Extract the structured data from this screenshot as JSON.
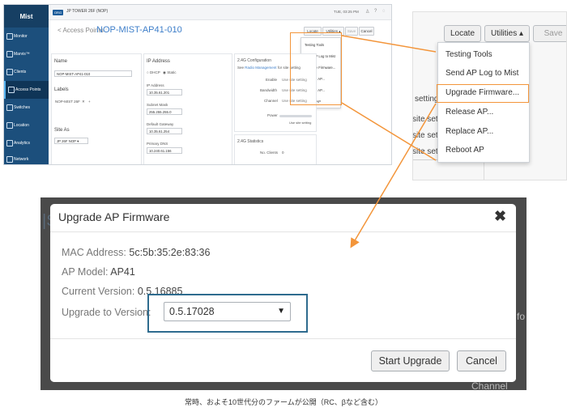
{
  "app": {
    "logo": "Mist",
    "org_badge": "ORG",
    "org_name": "JP TOWER 26F (NOP)",
    "time": "TUE, 03:25 PM",
    "sidebar": [
      {
        "label": "Monitor"
      },
      {
        "label": "Marvis™"
      },
      {
        "label": "Clients"
      },
      {
        "label": "Access Points"
      },
      {
        "label": "Switches"
      },
      {
        "label": "Location"
      },
      {
        "label": "Analytics"
      },
      {
        "label": "Network"
      }
    ],
    "back_label": "< Access Points :",
    "ap_title": "NOP-MIST-AP41-010",
    "toolbar": {
      "locate": "Locate",
      "utilities": "Utilities ▴",
      "save": "Save",
      "cancel": "Cancel"
    },
    "menu": [
      "Testing Tools",
      "Send AP Log to Mist",
      "Upgrade Firmware...",
      "Release AP...",
      "Replace AP...",
      "Reboot AP"
    ],
    "name_label": "Name",
    "name_value": "NOP-MIST-AP41-010",
    "labels_label": "Labels",
    "label_tag": "NOP-MIST 26F",
    "site_as_label": "Site As",
    "site_as_value": "JP 26F NOP",
    "ip_label": "IP Address",
    "ip_dhcp": "DHCP",
    "ip_static": "Static",
    "ip_addr_label": "IP Address",
    "ip_addr": "10.35.61.201",
    "mask_label": "Subnet Mask",
    "mask": "255.255.255.0",
    "gw_label": "Default Gateway",
    "gw": "10.35.61.254",
    "dns_label": "Primary DNS",
    "dns": "10.240.61.156",
    "cfg_title": "2.4G Configuration",
    "cfg_see": "See",
    "cfg_link": "Radio Management",
    "cfg_see_tail": "for site setting",
    "cfg_rows": [
      {
        "label": "Enable",
        "val": "Use site setting"
      },
      {
        "label": "Bandwidth",
        "val": "Use site setting"
      },
      {
        "label": "Channel",
        "val": "Use site setting"
      },
      {
        "label": "Power",
        "val": ""
      }
    ],
    "cfg_power_note": "Use site setting",
    "stats_title": "2.4G Statistics",
    "stats_row": "No. Clients",
    "stats_val": "0"
  },
  "zoom": {
    "locate": "Locate",
    "utilities": "Utilities ▴",
    "save": "Save",
    "behind_texts": [
      "setting",
      "site set",
      "site set",
      "site set"
    ],
    "menu": [
      "Testing Tools",
      "Send AP Log to Mist",
      "Upgrade Firmware...",
      "Release AP...",
      "Replace AP...",
      "Reboot AP"
    ]
  },
  "modal": {
    "title": "Upgrade AP Firmware",
    "close": "✖",
    "mac_label": "MAC Address:",
    "mac_value": "5c:5b:35:2e:83:36",
    "model_label": "AP Model:",
    "model_value": "AP41",
    "current_label": "Current Version:",
    "current_value": "0.5.16885",
    "upgrade_label": "Upgrade to Version:",
    "upgrade_value": "0.5.17028",
    "start_button": "Start Upgrade",
    "cancel_button": "Cancel",
    "peek_left": "|S",
    "peek_right": "fo",
    "peek_bottom": "Channel"
  },
  "caption": "常時、およそ10世代分のファームが公開（RC、βなど含む）",
  "colors": {
    "highlight_orange": "#f3953a",
    "highlight_blue": "#2e6b8e",
    "sidebar": "#1c4f7c",
    "accent": "#3d7ec9"
  },
  "icons": [
    "back-chevron-icon",
    "close-icon",
    "dropdown-caret-icon",
    "sidebar-nav-icon",
    "user-icon",
    "help-icon",
    "bell-icon"
  ]
}
